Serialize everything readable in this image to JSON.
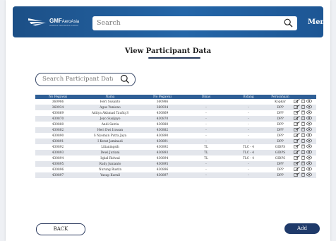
{
  "header": {
    "logo_main": "GMF",
    "logo_sub": "AeroAsia",
    "logo_tagline": "GARUDA INDONESIA GROUP",
    "search_placeholder": "Search",
    "menu_label": "Menu"
  },
  "page": {
    "title": "View Participant Data",
    "search_placeholder": "Search Participant Data"
  },
  "table": {
    "columns": [
      "No Pegawai",
      "Nama",
      "No Pegawai",
      "Dinas",
      "Bidang",
      "Perusahaan"
    ],
    "rows": [
      [
        "360986",
        "Heri Susanto",
        "360986",
        "",
        "",
        "Kopkar"
      ],
      [
        "360934",
        "Agus Yuniono",
        "360934",
        "-",
        "-",
        "DPP"
      ],
      [
        "430869",
        "Aditya Akhmad Taufiq S",
        "430869",
        "-",
        "-",
        "DPP"
      ],
      [
        "430870",
        "Joyo Susijayo",
        "430870",
        "-",
        "-",
        "DPP"
      ],
      [
        "430880",
        "Andi Satria",
        "430880",
        "-",
        "-",
        "DPP"
      ],
      [
        "430882",
        "Heri Dwi Irawan",
        "430882",
        "-",
        "-",
        "DPP"
      ],
      [
        "430890",
        "S Nyoman Putra Jaya",
        "430890",
        "-",
        "-",
        "DPP"
      ],
      [
        "430891",
        "I Ketut Jaminadi",
        "430891",
        "-",
        "-",
        "DPP"
      ],
      [
        "430892",
        "Lilianingsih",
        "430892",
        "TL",
        "TLC - 4",
        "GIDPS"
      ],
      [
        "430893",
        "Dewi Juriani",
        "430893",
        "TL",
        "TLC - 4",
        "GIDPS"
      ],
      [
        "430894",
        "Iqbal Ridwal",
        "430894",
        "TL",
        "TLC - 4",
        "GIDPS"
      ],
      [
        "430895",
        "Rudy Junianto",
        "430895",
        "-",
        "-",
        "DPP"
      ],
      [
        "430896",
        "Nurung Rustin",
        "430896",
        "-",
        "-",
        "DPP"
      ],
      [
        "430897",
        "Yusup Kurnil",
        "430897",
        "-",
        "-",
        "DPP"
      ]
    ]
  },
  "buttons": {
    "back": "BACK",
    "add": "Add"
  },
  "icons": {
    "edit": "edit-icon",
    "delete": "trash-icon",
    "view": "eye-icon",
    "search": "search-icon"
  },
  "colors": {
    "header_gradient": "#2466a8",
    "table_header": "#2f5f96",
    "add_button": "#1f3a6a",
    "row_stripe": "#e3e6ec"
  }
}
